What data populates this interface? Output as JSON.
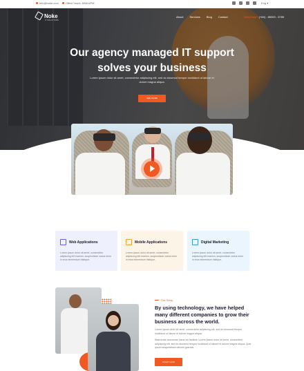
{
  "topbar": {
    "email": "info@noke.com",
    "hours": "Office hours: 8AM-6PM",
    "language": "Eng"
  },
  "nav": {
    "logo": "Noke",
    "logo_sub": "IT SOLUTIONS",
    "items": [
      "About",
      "Services",
      "Blog",
      "Contact"
    ],
    "cta": "Need help?",
    "phone": "(+84) - 85393 - 5789"
  },
  "hero": {
    "title_line1": "Our agency managed IT support",
    "title_line2": "solves your business",
    "subtitle": "Lorem ipsum dolor sit amet, consectetur adipiscing elit, sed do eiusmod tempor incididunt ut labore et dolore magna aliqua.",
    "button": "SEE MORE"
  },
  "services": [
    {
      "title": "Web Applications",
      "text": "Lorem ipsum dolor sit amet, consectetur adipiscing elit eranion, suspendisse varius enim in eros elementum tristique.",
      "bg": "#eef0fd",
      "accent": "#6a5ad8"
    },
    {
      "title": "Mobile Applications",
      "text": "Lorem ipsum dolor sit amet, consectetur adipiscing elit eranion, suspendisse varius enim in eros elementum tristique.",
      "bg": "#fdf4e8",
      "accent": "#f0a330"
    },
    {
      "title": "Digital Marketing",
      "text": "Lorem ipsum dolor sit amet, consectetur adipiscing elit eranion, suspendisse varius enim in eros elementum tristique.",
      "bg": "#eaf5fd",
      "accent": "#3a9ad9"
    }
  ],
  "about": {
    "eyebrow": "Our Story",
    "title": "By using technology, we have helped many different companies to grow their business across the world.",
    "p1": "Lorem ipsum dolor sit amet, consectetur adipiscing elit, sed do eiusmod tempor incididunt ut labore et dolore magna aliqua.",
    "p2": "Maecenas accumsan lacus vel facilisis. Lorem ipsum dolor sit amet, consectetur adipiscing elit, sed do eiusmod tempor incididunt ut labore et dolore magna aliqua. Quis ipsum suspendisse ultrices gravida.",
    "button": "START NOW"
  },
  "colors": {
    "accent": "#f05a22",
    "heading": "#1a1a2e"
  }
}
